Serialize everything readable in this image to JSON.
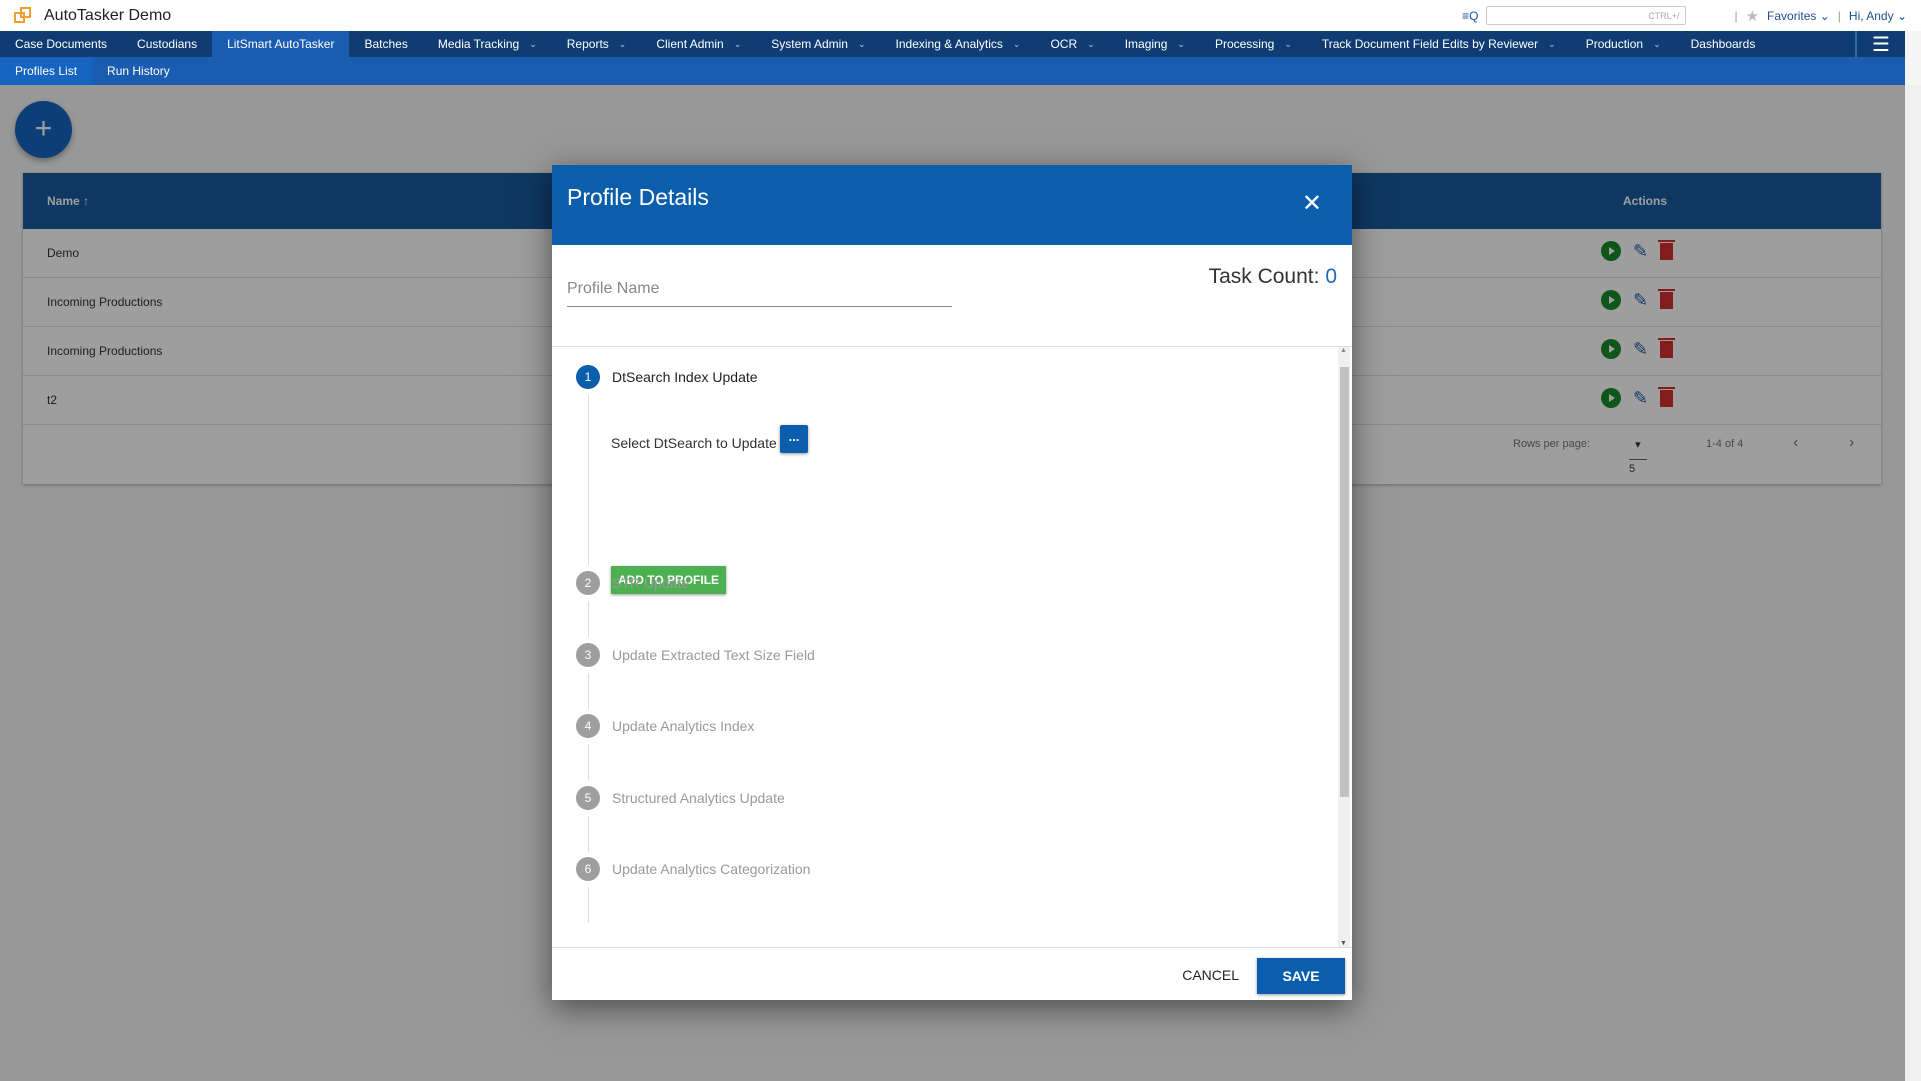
{
  "app": {
    "title": "AutoTasker Demo",
    "search_hint": "CTRL+/",
    "favorites": "Favorites",
    "user": "Hi, Andy"
  },
  "nav": [
    {
      "label": "Case Documents",
      "dropdown": false
    },
    {
      "label": "Custodians",
      "dropdown": false
    },
    {
      "label": "LitSmart AutoTasker",
      "dropdown": false,
      "active": true
    },
    {
      "label": "Batches",
      "dropdown": false
    },
    {
      "label": "Media Tracking",
      "dropdown": true
    },
    {
      "label": "Reports",
      "dropdown": true
    },
    {
      "label": "Client Admin",
      "dropdown": true
    },
    {
      "label": "System Admin",
      "dropdown": true
    },
    {
      "label": "Indexing & Analytics",
      "dropdown": true
    },
    {
      "label": "OCR",
      "dropdown": true
    },
    {
      "label": "Imaging",
      "dropdown": true
    },
    {
      "label": "Processing",
      "dropdown": true
    },
    {
      "label": "Track Document Field Edits by Reviewer",
      "dropdown": true
    },
    {
      "label": "Production",
      "dropdown": true
    },
    {
      "label": "Dashboards",
      "dropdown": false
    }
  ],
  "subnav": [
    {
      "label": "Profiles List",
      "active": true
    },
    {
      "label": "Run History"
    }
  ],
  "table": {
    "headers": {
      "name": "Name",
      "actions": "Actions"
    },
    "rows": [
      "Demo",
      "Incoming Productions",
      "Incoming Productions",
      "t2"
    ],
    "pager": {
      "rows_per_page_label": "Rows per page:",
      "rows_per_page": "5",
      "range": "1-4 of 4"
    }
  },
  "modal": {
    "title": "Profile Details",
    "profile_name_placeholder": "Profile Name",
    "task_count_label": "Task Count:",
    "task_count": "0",
    "steps": [
      {
        "n": "1",
        "label": "DtSearch Index Update"
      },
      {
        "n": "2",
        "label": "STR Update"
      },
      {
        "n": "3",
        "label": "Update Extracted Text Size Field"
      },
      {
        "n": "4",
        "label": "Update Analytics Index"
      },
      {
        "n": "5",
        "label": "Structured Analytics Update"
      },
      {
        "n": "6",
        "label": "Update Analytics Categorization"
      }
    ],
    "select_label": "Select DtSearch to Update",
    "browse_button": "...",
    "add_button": "ADD TO PROFILE",
    "cancel": "CANCEL",
    "save": "SAVE"
  },
  "colors": {
    "nav": "#0f3d73",
    "subnav": "#1a5cb0",
    "modal_header": "#0a5eab",
    "add_button": "#4caf50",
    "run": "#1b8a2a",
    "delete": "#d32f2f"
  }
}
